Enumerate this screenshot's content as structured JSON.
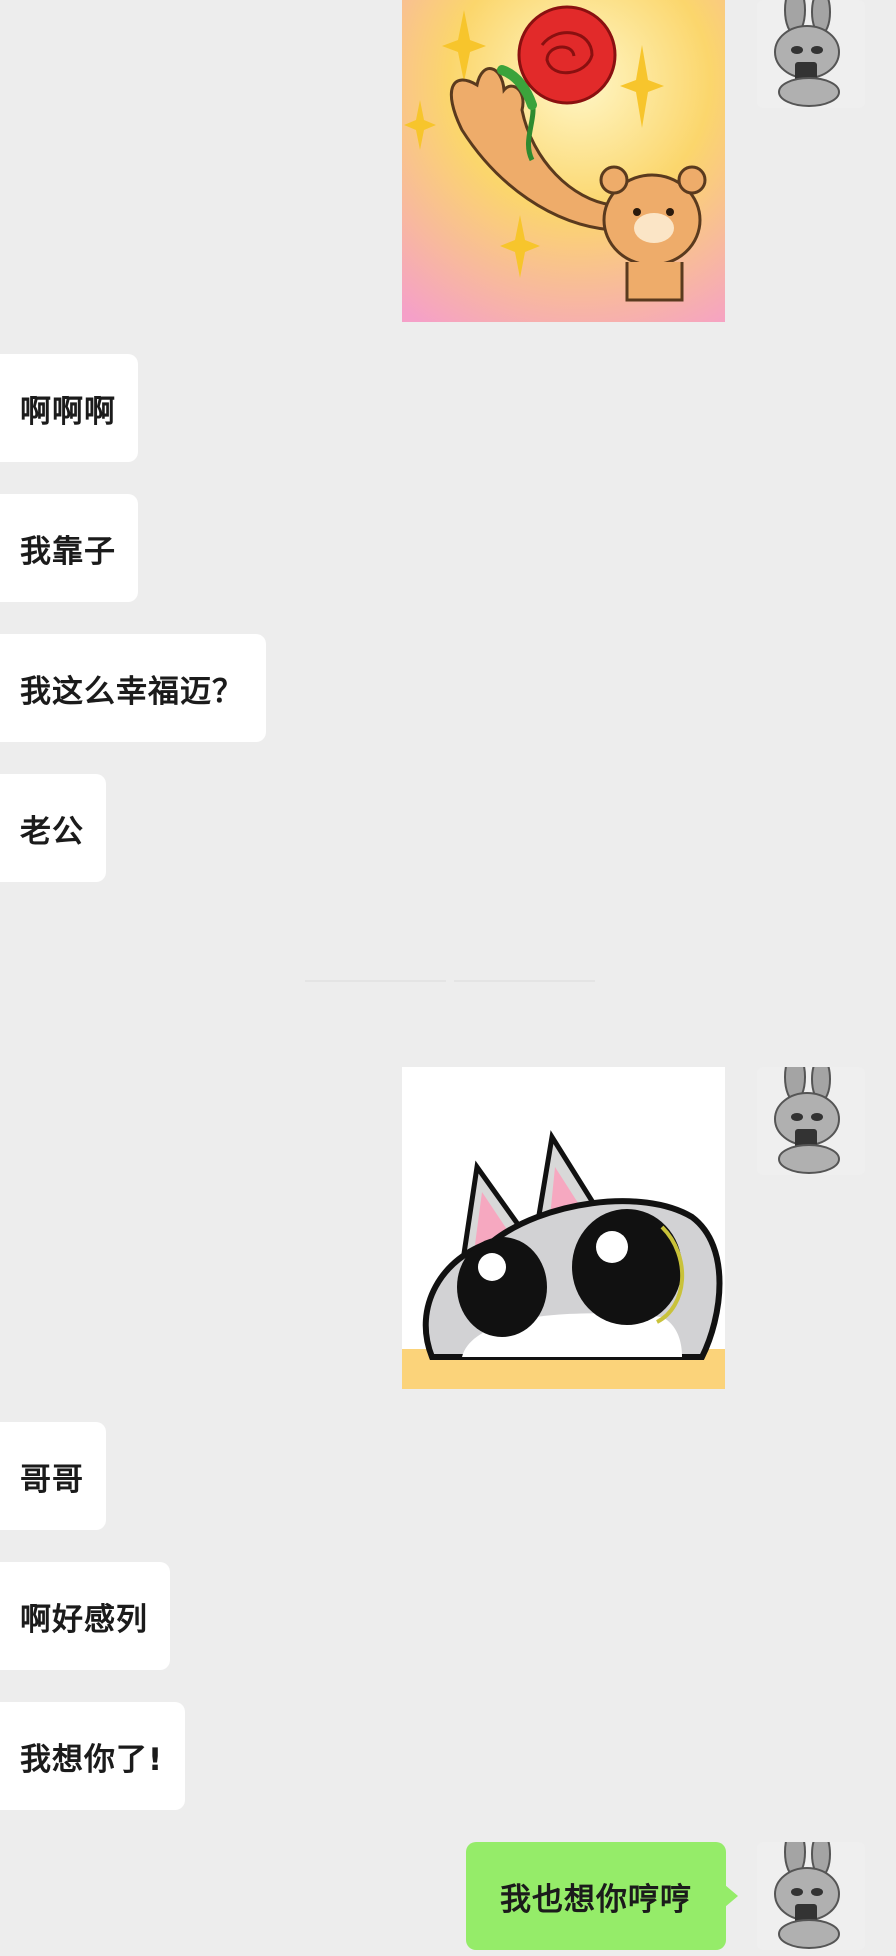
{
  "chat": {
    "incoming_group_1": [
      "啊啊啊",
      "我靠子",
      "我这么幸福迈？",
      "老公"
    ],
    "incoming_group_2": [
      "哥哥",
      "啊好感列",
      "我想你了!"
    ],
    "outgoing_last": "我也想你哼哼"
  },
  "stickers": {
    "first": "bear-holding-rose-sticker",
    "second": "gray-cat-peeking-sticker"
  },
  "avatars": "gray-bunny-avatar",
  "colors": {
    "background": "#ededed",
    "incoming_bubble": "#ffffff",
    "outgoing_bubble": "#95ec69"
  }
}
